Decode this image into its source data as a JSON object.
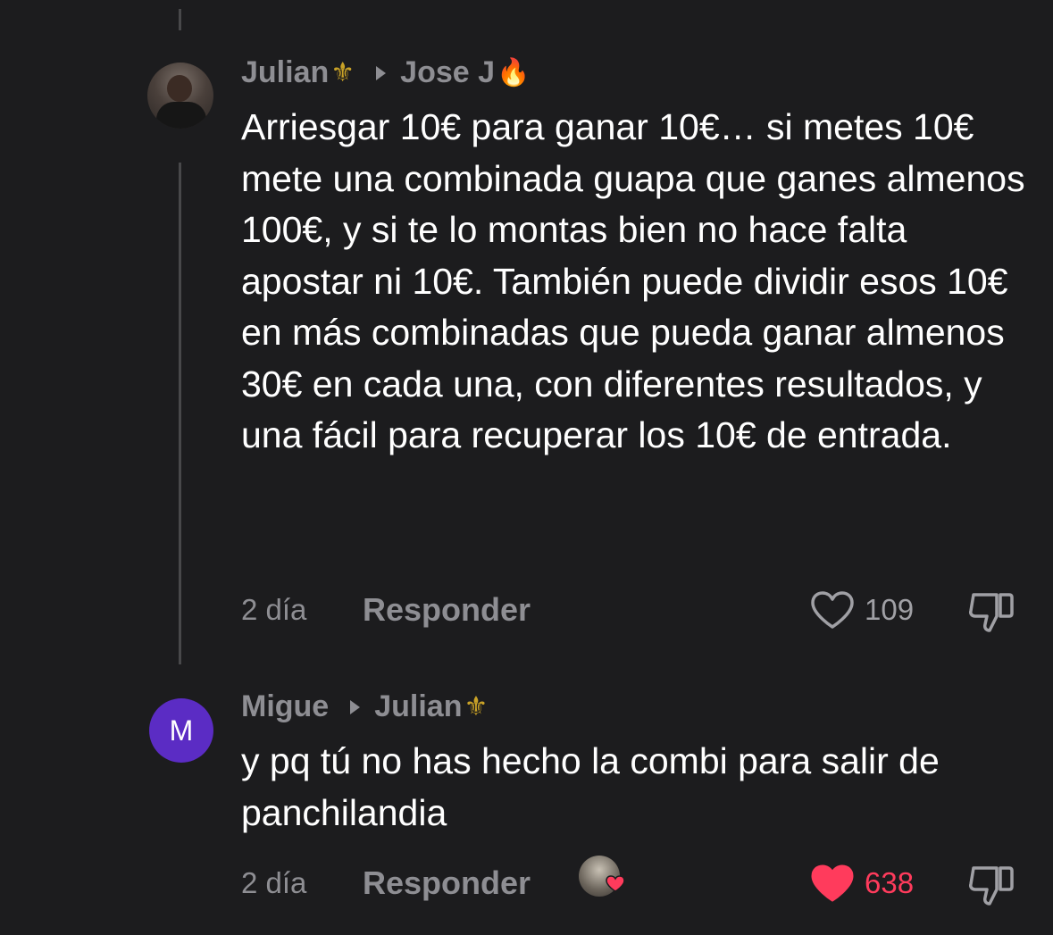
{
  "comments": [
    {
      "author": "Julian",
      "author_emoji": "⚜",
      "reply_to": "Jose J",
      "reply_to_emoji": "🔥",
      "avatar_icon": "user-photo-avatar",
      "text": "Arriesgar 10€ para ganar 10€… si metes 10€ mete una combinada guapa que ganes almenos 100€, y si te lo montas bien no hace falta apostar ni 10€. También puede dividir esos 10€ en más combinadas que pueda ganar almenos 30€ en cada una, con diferentes resultados, y una fácil para recuperar los 10€ de entrada.",
      "time": "2 día",
      "reply_label": "Responder",
      "likes": "109",
      "liked": false
    },
    {
      "author": "Migue",
      "avatar_letter": "M",
      "avatar_color": "#5b2cc4",
      "reply_to": "Julian",
      "reply_to_emoji": "⚜",
      "text": "y pq tú no has hecho la combi para salir de panchilandia",
      "time": "2 día",
      "reply_label": "Responder",
      "likes": "638",
      "liked": true,
      "liked_by_creator": true
    }
  ],
  "colors": {
    "background": "#1c1c1e",
    "muted": "#8e8e93",
    "like_active": "#ff3b5c",
    "thread_line": "#48484a"
  }
}
